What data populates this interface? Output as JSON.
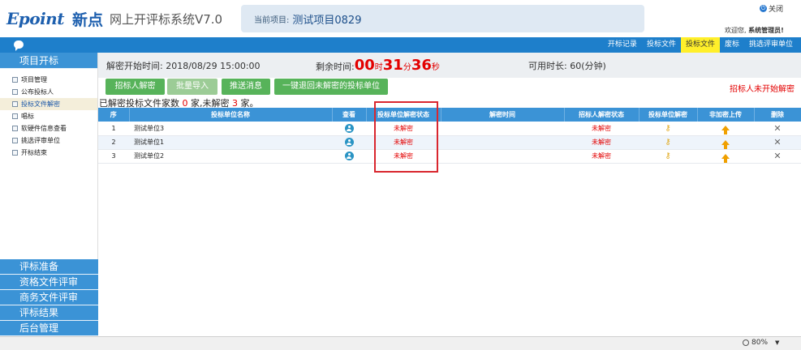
{
  "header": {
    "brand": "Epoint",
    "brand_cn": "新点",
    "system_name": "网上开评标系统V7.0",
    "project_label": "当前项目:",
    "project_name": "测试项目0829",
    "close_label": "关闭",
    "welcome_prefix": "欢迎您,",
    "user_name": "系统管理员!"
  },
  "topnav": {
    "tabs": [
      {
        "label": "开标记录",
        "active": false
      },
      {
        "label": "投标文件",
        "active": false
      },
      {
        "label": "投标文件",
        "active": true
      },
      {
        "label": "废标",
        "active": false
      },
      {
        "label": "挑选评审单位",
        "active": false
      }
    ]
  },
  "sidebar": {
    "header": "项目开标",
    "items": [
      {
        "label": "项目管理",
        "active": false
      },
      {
        "label": "公布投标人",
        "active": false
      },
      {
        "label": "投标文件解密",
        "active": true
      },
      {
        "label": "唱标",
        "active": false
      },
      {
        "label": "软硬件信息查看",
        "active": false
      },
      {
        "label": "挑选评审单位",
        "active": false
      },
      {
        "label": "开标结束",
        "active": false
      }
    ],
    "sections": [
      "评标准备",
      "资格文件评审",
      "商务文件评审",
      "评标结果",
      "后台管理"
    ]
  },
  "info": {
    "start_label": "解密开始时间:",
    "start_time": "2018/08/29 15:00:00",
    "remain_label": "剩余时间:",
    "remain_hours": "00",
    "remain_hours_unit": "时",
    "remain_minutes": "31",
    "remain_minutes_unit": "分",
    "remain_seconds": "36",
    "remain_seconds_unit": "秒",
    "avail_label": "可用时长:",
    "avail_value": "60(分钟)"
  },
  "actions": {
    "buttons": [
      "招标人解密",
      "批量导入",
      "推送消息",
      "一键退回未解密的投标单位"
    ],
    "warning": "招标人未开始解密"
  },
  "summary": {
    "prefix": "已解密投标文件家数",
    "decrypted": "0",
    "mid": "家,未解密",
    "undecrypted": "3",
    "suffix": "家。"
  },
  "table": {
    "headers": [
      "序",
      "投标单位名称",
      "查看",
      "投标单位解密状态",
      "解密时间",
      "招标人解密状态",
      "投标单位解密",
      "非加密上传",
      "删除"
    ],
    "rows": [
      {
        "index": "1",
        "name": "测试单位3",
        "bidder_status": "未解密",
        "decrypt_time": "",
        "tenderer_status": "未解密"
      },
      {
        "index": "2",
        "name": "测试单位1",
        "bidder_status": "未解密",
        "decrypt_time": "",
        "tenderer_status": "未解密"
      },
      {
        "index": "3",
        "name": "测试单位2",
        "bidder_status": "未解密",
        "decrypt_time": "",
        "tenderer_status": "未解密"
      }
    ]
  },
  "statusbar": {
    "zoom": "80%"
  },
  "colors": {
    "primary_blue": "#1e7fcb",
    "sidebar_blue": "#3b93d6",
    "button_green": "#57b35a",
    "alert_red": "#e30000",
    "active_tab_yellow": "#ffef2a"
  }
}
